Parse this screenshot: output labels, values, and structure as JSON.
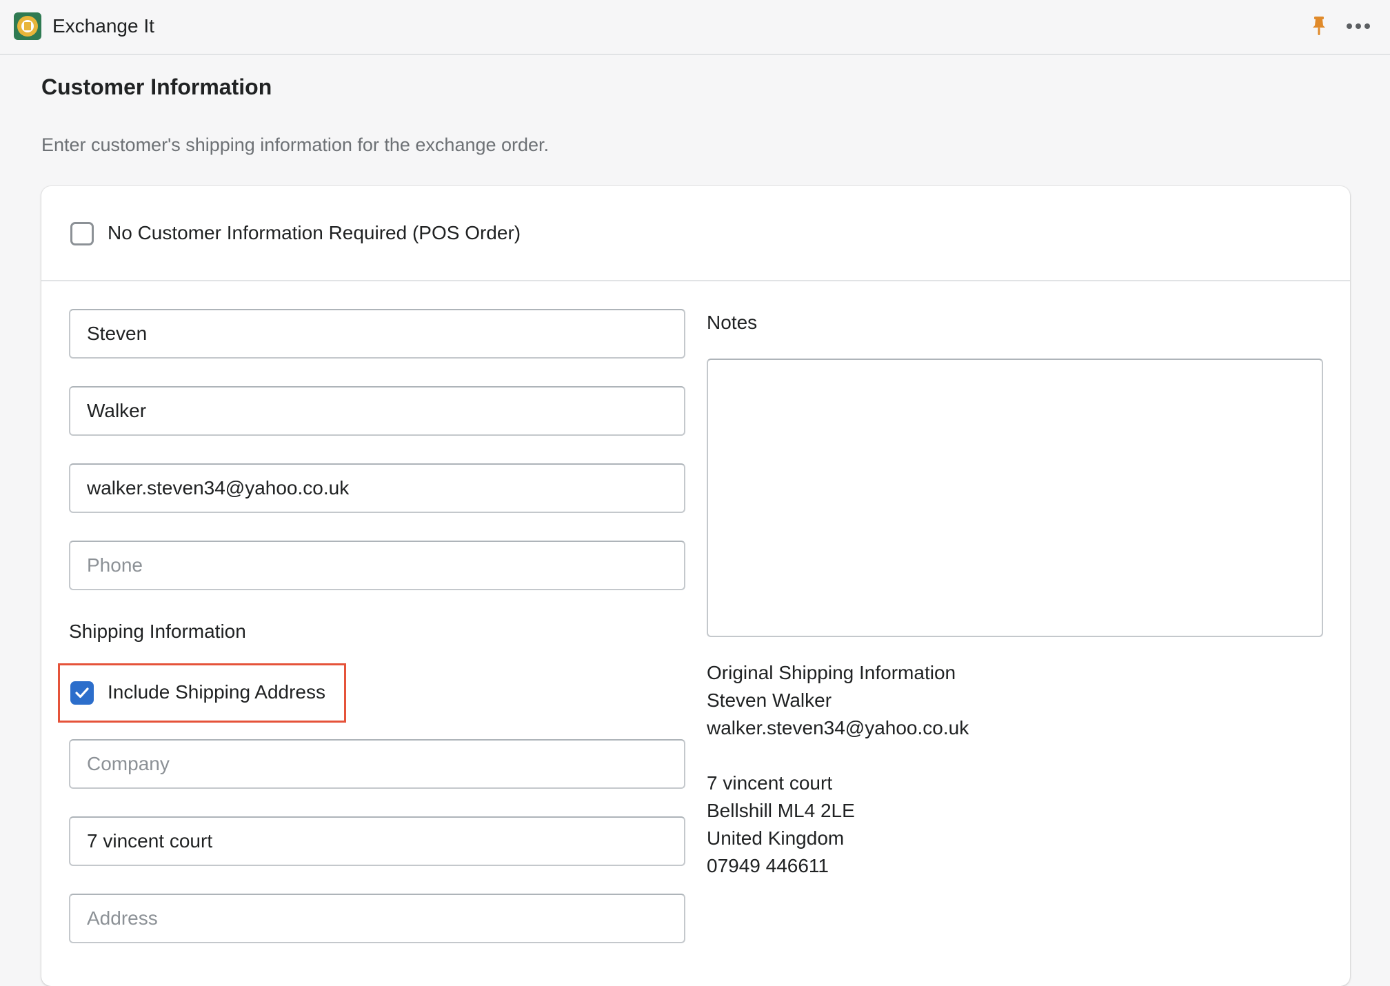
{
  "app": {
    "title": "Exchange It"
  },
  "icons": {
    "logo": "exchange-it-logo",
    "pin": "pin-icon",
    "more": "more-horizontal-icon",
    "check": "checkmark-icon"
  },
  "colors": {
    "accent": "#2c6ecb",
    "pin": "#e08a2a",
    "highlight": "#e5533a"
  },
  "page": {
    "title": "Customer Information",
    "subtitle": "Enter customer's shipping information for the exchange order."
  },
  "pos_checkbox": {
    "label": "No Customer Information Required (POS Order)",
    "checked": false
  },
  "fields": {
    "first_name": {
      "value": "Steven",
      "placeholder": ""
    },
    "last_name": {
      "value": "Walker",
      "placeholder": ""
    },
    "email": {
      "value": "walker.steven34@yahoo.co.uk",
      "placeholder": ""
    },
    "phone": {
      "value": "",
      "placeholder": "Phone"
    },
    "company": {
      "value": "",
      "placeholder": "Company"
    },
    "address1": {
      "value": "7 vincent court",
      "placeholder": ""
    },
    "address2": {
      "value": "",
      "placeholder": "Address"
    }
  },
  "shipping": {
    "section_label": "Shipping Information",
    "include_label": "Include Shipping Address",
    "include_checked": true
  },
  "notes": {
    "label": "Notes",
    "value": ""
  },
  "original_shipping": {
    "heading": "Original Shipping Information",
    "name": "Steven Walker",
    "email": "walker.steven34@yahoo.co.uk",
    "street": "7 vincent court",
    "city": "Bellshill ML4 2LE",
    "country": "United Kingdom",
    "phone": "07949 446611"
  }
}
